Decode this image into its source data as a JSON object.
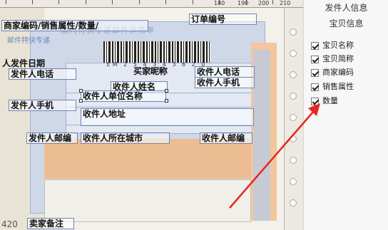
{
  "ruler": {
    "numbers": [
      "180",
      "190",
      "200",
      "210"
    ]
  },
  "waybill": {
    "faded_title": "国内特快专递邮件详情单",
    "faded_sub": "邮件特快专递",
    "barcode_number": "EM 2 5 4 3 4 3 6 2 0 C N"
  },
  "fields": {
    "seller_code_attr": "商家编码/销售属性/数量/",
    "order_number": "订单编号",
    "sender_date": "人发件日期",
    "sender_phone": "发件人电话",
    "buyer_nick": "买家昵称",
    "receiver_phone": "收件人电话",
    "receiver_name": "收件人姓名",
    "receiver_mobile": "收件人手机",
    "receiver_company": "收件人单位名称",
    "sender_mobile": "发件人手机",
    "receiver_address": "收件人地址",
    "sender_zip": "发件人邮编",
    "receiver_city": "收件人所在城市",
    "receiver_zip": "收件人邮编",
    "seller_note": "卖家备注",
    "bottom_number": "420"
  },
  "panel": {
    "sender_info": "发件人信息",
    "item_info": "宝贝信息",
    "options": [
      {
        "label": "宝贝名称",
        "checked": true
      },
      {
        "label": "宝贝简称",
        "checked": true
      },
      {
        "label": "商家编码",
        "checked": true
      },
      {
        "label": "销售属性",
        "checked": true
      },
      {
        "label": "数量",
        "checked": true
      }
    ]
  },
  "colors": {
    "arrow": "#e8251f",
    "field_border": "#6f86b4",
    "blue_panel": "#cfd8e8",
    "orange_panel": "#f1b983"
  }
}
